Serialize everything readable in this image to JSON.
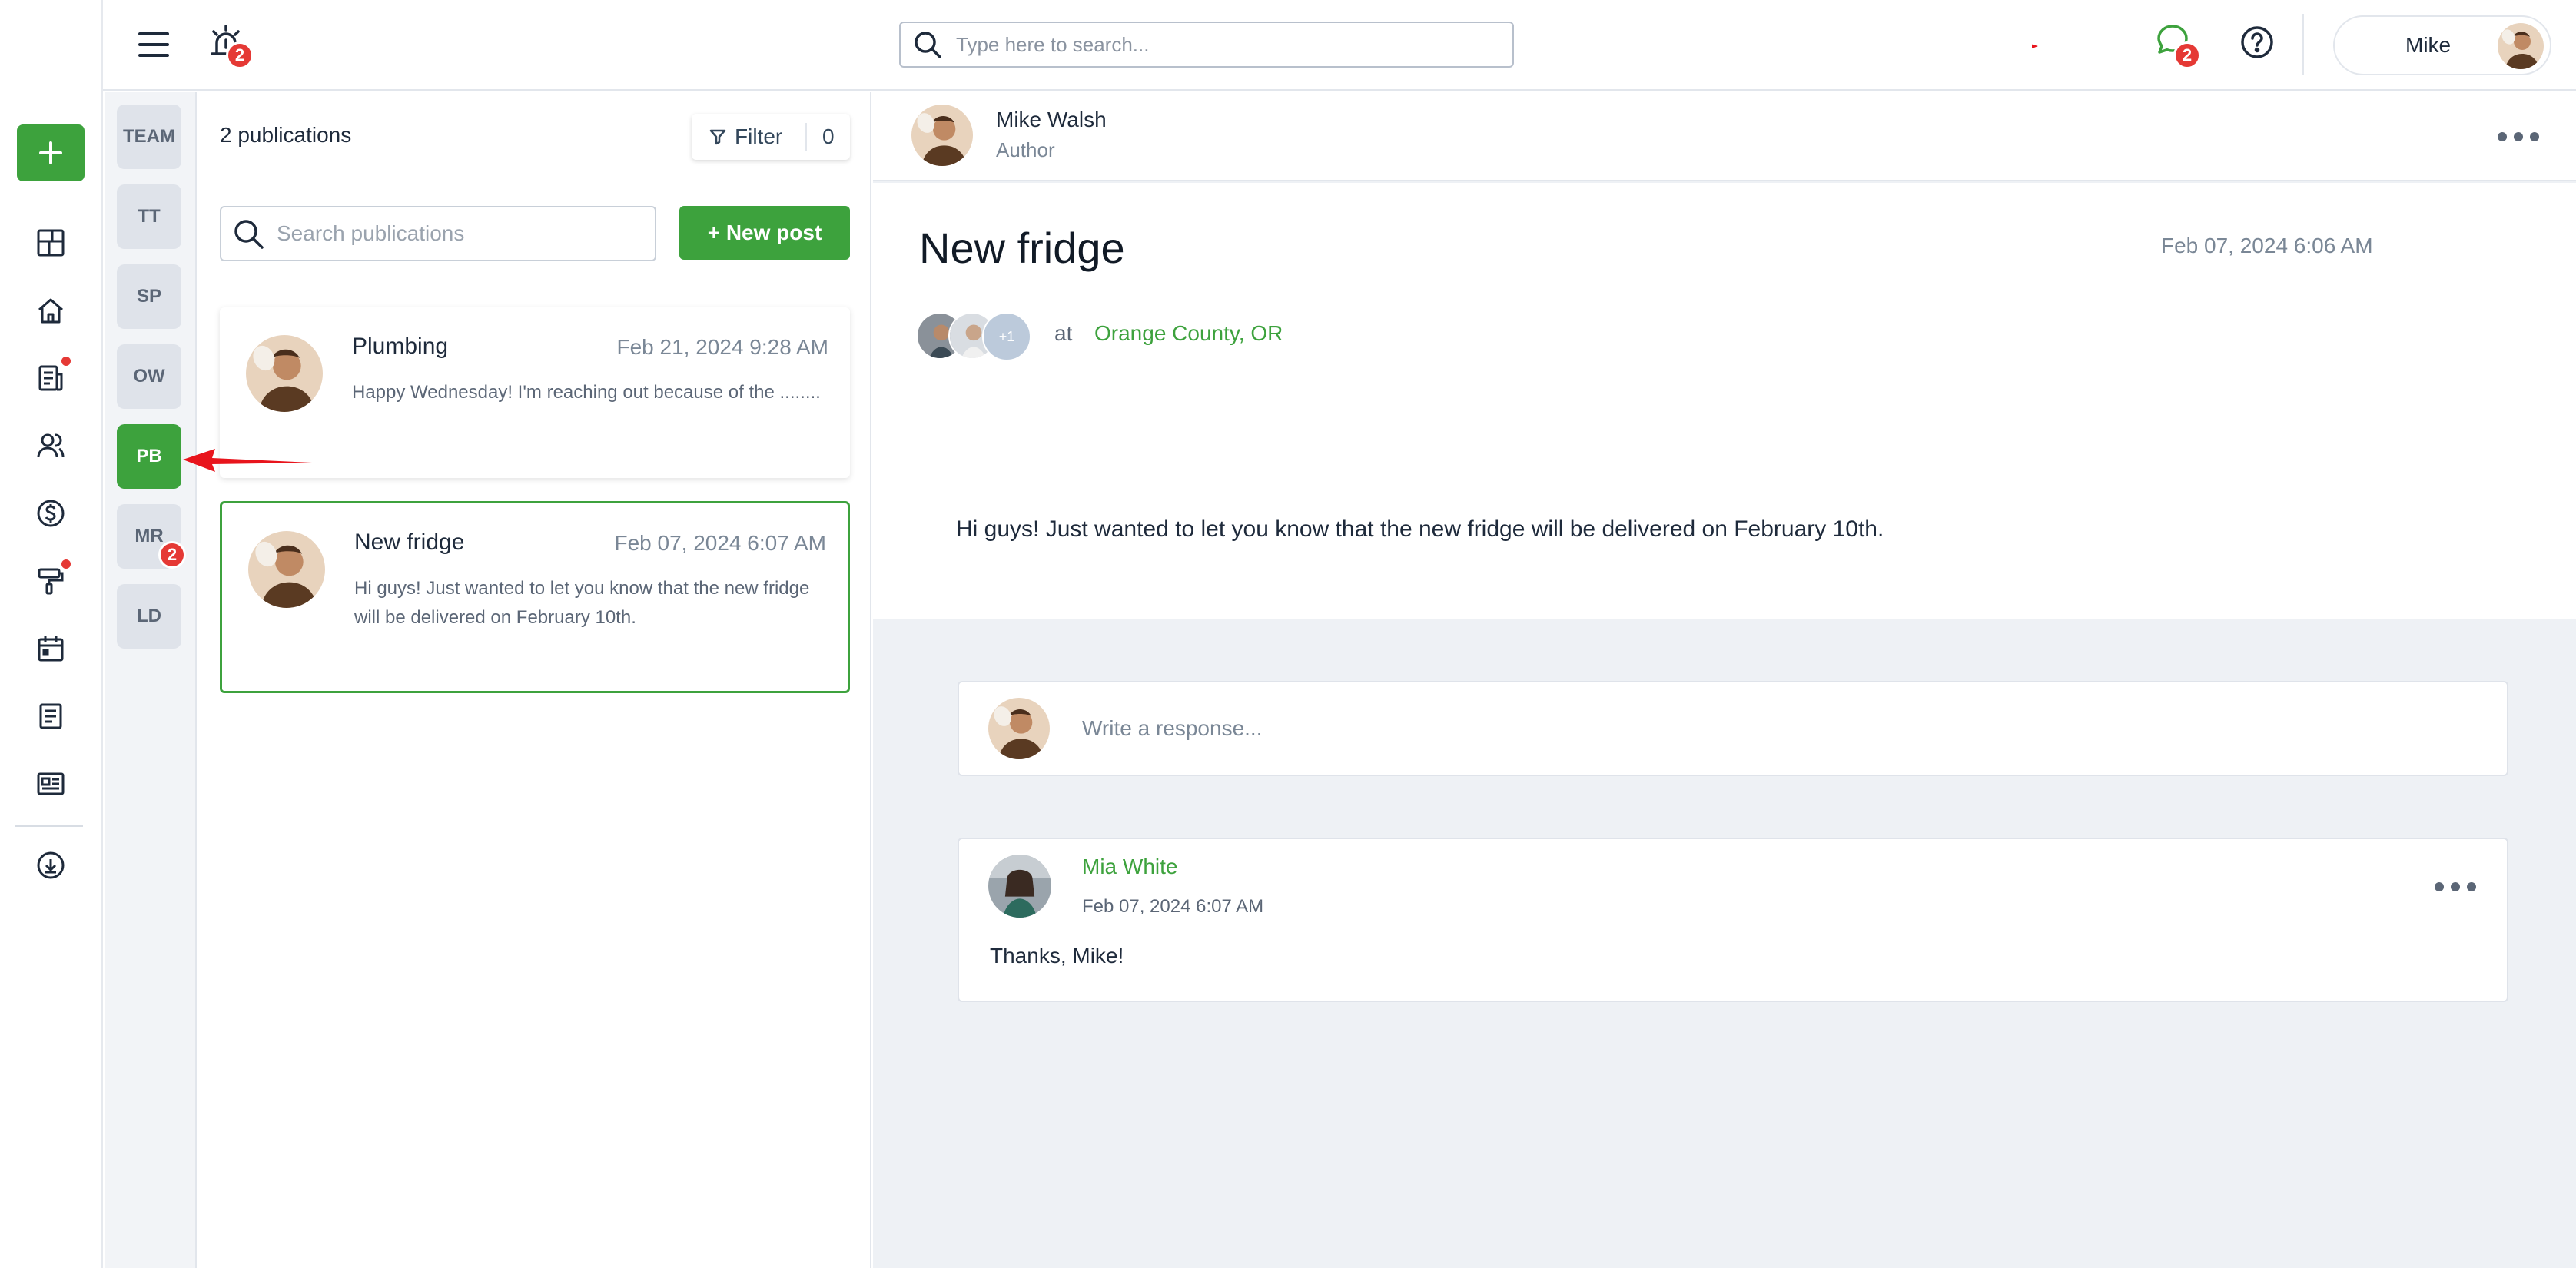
{
  "topbar": {
    "search_placeholder": "Type here to search...",
    "alarm_badge": "2",
    "chat_badge": "2",
    "user_name": "Mike"
  },
  "teams": [
    {
      "label": "TEAM"
    },
    {
      "label": "TT"
    },
    {
      "label": "SP"
    },
    {
      "label": "OW"
    },
    {
      "label": "PB",
      "active": true
    },
    {
      "label": "MR",
      "badge": "2"
    },
    {
      "label": "LD"
    }
  ],
  "publications": {
    "count_label": "2 publications",
    "filter_label": "Filter",
    "filter_count": "0",
    "search_placeholder": "Search publications",
    "new_post_label": "+ New post",
    "items": [
      {
        "title": "Plumbing",
        "date": "Feb 21, 2024 9:28 AM",
        "excerpt": "Happy Wednesday! I'm reaching out because of the ........"
      },
      {
        "title": "New fridge",
        "date": "Feb 07, 2024 6:07 AM",
        "excerpt": "Hi guys! Just wanted to let you know that the new fridge will be delivered on February 10th.",
        "selected": true
      }
    ]
  },
  "post": {
    "author_name": "Mike Walsh",
    "author_role": "Author",
    "title": "New fridge",
    "date": "Feb 07, 2024 6:06 AM",
    "plus_more": "+1",
    "at_label": "at",
    "location": "Orange County, OR",
    "body": "Hi guys! Just wanted to let you know that the new fridge will be delivered on February 10th.",
    "response_placeholder": "Write a response..."
  },
  "comments": [
    {
      "author": "Mia White",
      "date": "Feb 07, 2024 6:07 AM",
      "text": "Thanks, Mike!"
    }
  ],
  "colors": {
    "accent": "#3da23d",
    "badge": "#e53935",
    "annotation_arrow": "#e8141c"
  }
}
